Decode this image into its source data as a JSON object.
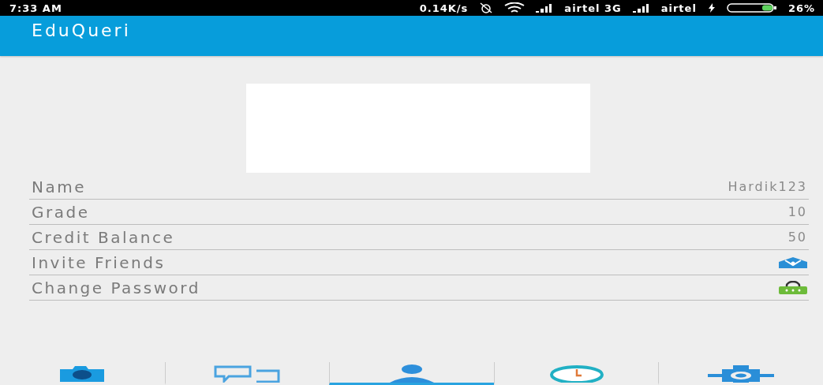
{
  "status_bar": {
    "time": "7:33 AM",
    "speed": "0.14K/s",
    "carrier_1": "airtel 3G",
    "carrier_2": "airtel",
    "battery": "26%"
  },
  "app_bar": {
    "title": "EduQueri"
  },
  "profile_rows": [
    {
      "label": "Name",
      "kind": "value",
      "value": "Hardik123"
    },
    {
      "label": "Grade",
      "kind": "value",
      "value": "10"
    },
    {
      "label": "Credit Balance",
      "kind": "value",
      "value": "50"
    },
    {
      "label": "Invite Friends",
      "kind": "envelope"
    },
    {
      "label": "Change Password",
      "kind": "padlock"
    }
  ],
  "bottom_tabs": [
    {
      "kind": "camera",
      "selected": false
    },
    {
      "kind": "chat",
      "selected": false
    },
    {
      "kind": "person",
      "selected": true
    },
    {
      "kind": "clock",
      "selected": false
    },
    {
      "kind": "gear",
      "selected": false
    }
  ]
}
